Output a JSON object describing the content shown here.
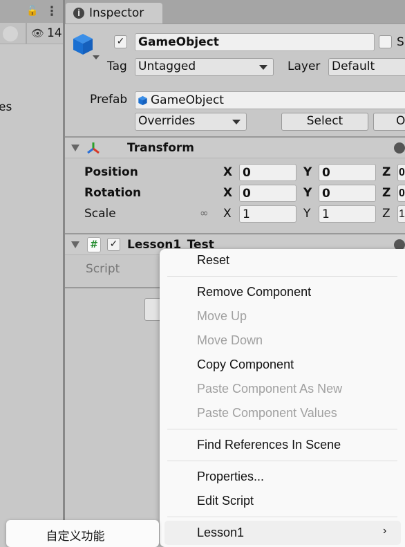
{
  "left_panel": {
    "count": "14",
    "partial_text": "es"
  },
  "tab": {
    "label": "Inspector"
  },
  "object": {
    "active": true,
    "name": "GameObject",
    "static_label": "S",
    "tag_label": "Tag",
    "tag": "Untagged",
    "layer_label": "Layer",
    "layer": "Default",
    "prefab_label": "Prefab",
    "prefab": "GameObject",
    "overrides": "Overrides",
    "select": "Select",
    "open": "O"
  },
  "transform": {
    "title": "Transform",
    "rows": [
      {
        "label": "Position",
        "x": "0",
        "y": "0",
        "z": "0"
      },
      {
        "label": "Rotation",
        "x": "0",
        "y": "0",
        "z": "0"
      },
      {
        "label": "Scale",
        "x": "1",
        "y": "1",
        "z": "1"
      }
    ],
    "axis": {
      "x": "X",
      "y": "Y",
      "z": "Z"
    }
  },
  "component": {
    "title": "Lesson1_Test",
    "enabled": true,
    "script_label": "Script"
  },
  "context_menu": {
    "items": [
      {
        "label": "Reset",
        "enabled": true
      },
      {
        "label": "Remove Component",
        "enabled": true
      },
      {
        "label": "Move Up",
        "enabled": false
      },
      {
        "label": "Move Down",
        "enabled": false
      },
      {
        "label": "Copy Component",
        "enabled": true
      },
      {
        "label": "Paste Component As New",
        "enabled": false
      },
      {
        "label": "Paste Component Values",
        "enabled": false
      },
      {
        "label": "Find References In Scene",
        "enabled": true
      },
      {
        "label": "Properties...",
        "enabled": true
      },
      {
        "label": "Edit Script",
        "enabled": true
      },
      {
        "label": "Lesson1",
        "enabled": true,
        "submenu": true
      }
    ]
  },
  "submenu": {
    "items": [
      {
        "label": "自定义功能"
      }
    ]
  },
  "colors": {
    "cube": "#1a73d9",
    "menu_bg": "#f9f9f9",
    "highlight": "#efefef"
  }
}
